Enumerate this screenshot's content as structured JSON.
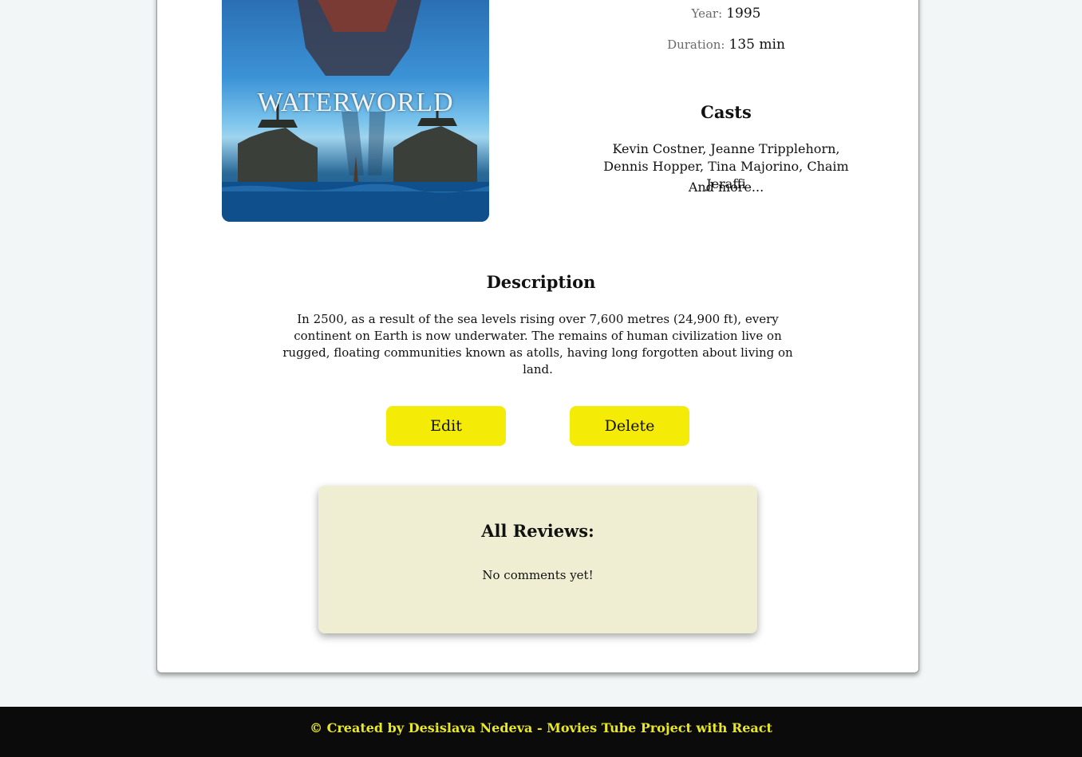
{
  "movie": {
    "poster_title": "WATERWORLD",
    "year_label": "Year:",
    "year": "1995",
    "duration_label": "Duration:",
    "duration": "135 min",
    "casts_heading": "Casts",
    "casts": "Kevin Costner, Jeanne Tripplehorn, Dennis Hopper, Tina Majorino, Chaim Jeraffi",
    "casts_more": "And more...",
    "description_heading": "Description",
    "description": "In 2500, as a result of the sea levels rising over 7,600 metres (24,900 ft), every continent on Earth is now underwater. The remains of human civilization live on rugged, floating communities known as atolls, having long forgotten about living on land."
  },
  "actions": {
    "edit_label": "Edit",
    "delete_label": "Delete"
  },
  "reviews": {
    "heading": "All Reviews:",
    "empty_text": "No comments yet!"
  },
  "footer": {
    "text": "© Created by Desislava Nedeva - Movies Tube Project with React"
  },
  "colors": {
    "button": "#f4eb06",
    "reviews_bg": "#efeed3",
    "footer_bg": "#0b0b0b",
    "footer_text": "#e8e827"
  }
}
